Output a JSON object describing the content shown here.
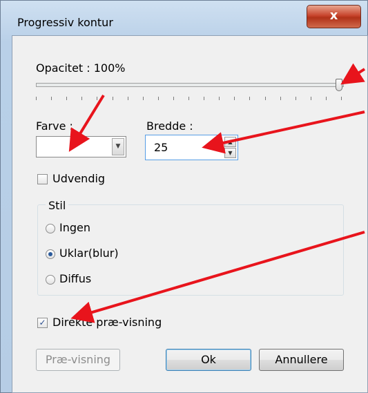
{
  "window": {
    "title": "Progressiv kontur",
    "close_glyph": "x"
  },
  "opacity": {
    "label": "Opacitet : 100%",
    "value_percent": 100
  },
  "color": {
    "label": "Farve :",
    "value": ""
  },
  "width": {
    "label": "Bredde :",
    "value": "25"
  },
  "outside": {
    "label": "Udvendig",
    "checked": false
  },
  "style_group": {
    "title": "Stil",
    "options": [
      {
        "label": "Ingen",
        "selected": false
      },
      {
        "label": "Uklar(blur)",
        "selected": true
      },
      {
        "label": "Diffus",
        "selected": false
      }
    ]
  },
  "live_preview": {
    "label": "Direkte præ-visning",
    "checked": true
  },
  "buttons": {
    "preview": "Præ-visning",
    "ok": "Ok",
    "cancel": "Annullere"
  },
  "annotation_color": "#e8141c",
  "icons": [
    "close-icon",
    "dropdown-arrow-icon",
    "spin-up-icon",
    "spin-down-icon",
    "checkmark-icon"
  ]
}
